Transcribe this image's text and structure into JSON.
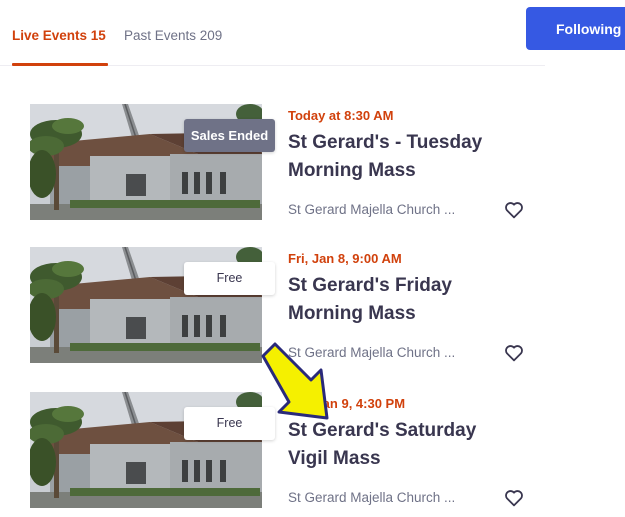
{
  "tabs": [
    {
      "label": "Live Events 15"
    },
    {
      "label": "Past Events 209"
    }
  ],
  "follow_button": {
    "label": "Following"
  },
  "events": [
    {
      "badge": "Sales Ended",
      "date": "Today at 8:30 AM",
      "title": "St Gerard's - Tuesday Morning Mass",
      "venue": "St Gerard Majella Church ..."
    },
    {
      "badge": "Free",
      "date": "Fri, Jan 8, 9:00 AM",
      "title": "St Gerard's Friday Morning Mass",
      "venue": "St Gerard Majella Church ..."
    },
    {
      "badge": "Free",
      "date": "Sat, Jan 9, 4:30 PM",
      "title": "St Gerard's Saturday Vigil Mass",
      "venue": "St Gerard Majella Church ..."
    }
  ],
  "colors": {
    "accent": "#d1410c",
    "follow_button_bg": "#3659e3",
    "sales_ended_badge": "#6f7287",
    "annotation_arrow": "#f5f000"
  },
  "icons": {
    "save": "heart-icon",
    "annotation": "arrow-annotation-icon"
  }
}
